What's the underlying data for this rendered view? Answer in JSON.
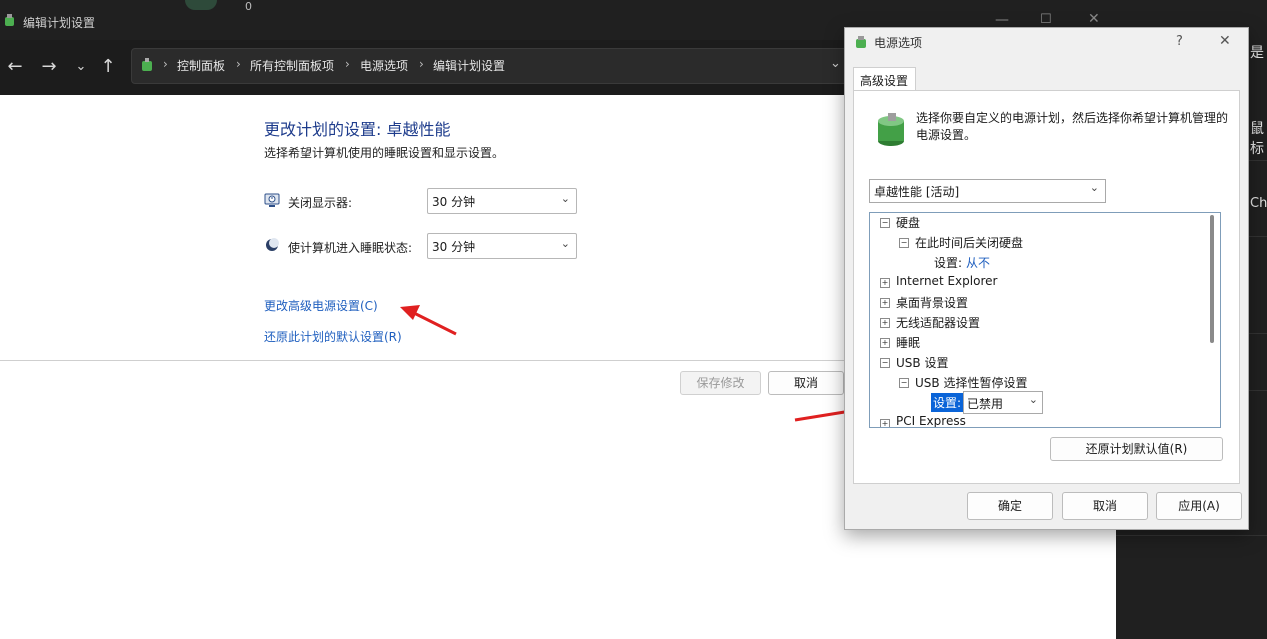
{
  "main_window": {
    "title": "编辑计划设置",
    "breadcrumb": [
      "控制面板",
      "所有控制面板项",
      "电源选项",
      "编辑计划设置"
    ],
    "heading": "更改计划的设置: 卓越性能",
    "subheading": "选择希望计算机使用的睡眠设置和显示设置。",
    "display_off_label": "关闭显示器:",
    "display_off_value": "30 分钟",
    "sleep_label": "使计算机进入睡眠状态:",
    "sleep_value": "30 分钟",
    "advanced_link": "更改高级电源设置(C)",
    "restore_link": "还原此计划的默认设置(R)",
    "save_button": "保存修改",
    "cancel_button": "取消"
  },
  "dialog": {
    "title": "电源选项",
    "help": "?",
    "close": "✕",
    "tab": "高级设置",
    "description": "选择你要自定义的电源计划，然后选择你希望计算机管理的电源设置。",
    "plan_selected": "卓越性能 [活动]",
    "tree": {
      "hdd": "硬盘",
      "hdd_off": "在此时间后关闭硬盘",
      "hdd_setting_label": "设置:",
      "hdd_setting_value": "从不",
      "ie": "Internet Explorer",
      "desktop_bg": "桌面背景设置",
      "wireless": "无线适配器设置",
      "sleep": "睡眠",
      "usb": "USB 设置",
      "usb_suspend": "USB 选择性暂停设置",
      "usb_setting_label": "设置:",
      "usb_setting_value": "已禁用",
      "pci": "PCI Express"
    },
    "restore_defaults": "还原计划默认值(R)",
    "ok": "确定",
    "cancel": "取消",
    "apply": "应用(A)"
  },
  "backdrop": {
    "chars": [
      "是",
      "鼠标",
      "Chd",
      "0"
    ]
  },
  "colors": {
    "arrow": "#e02020",
    "link": "#1f5fbf",
    "highlight": "#0a64d8"
  }
}
